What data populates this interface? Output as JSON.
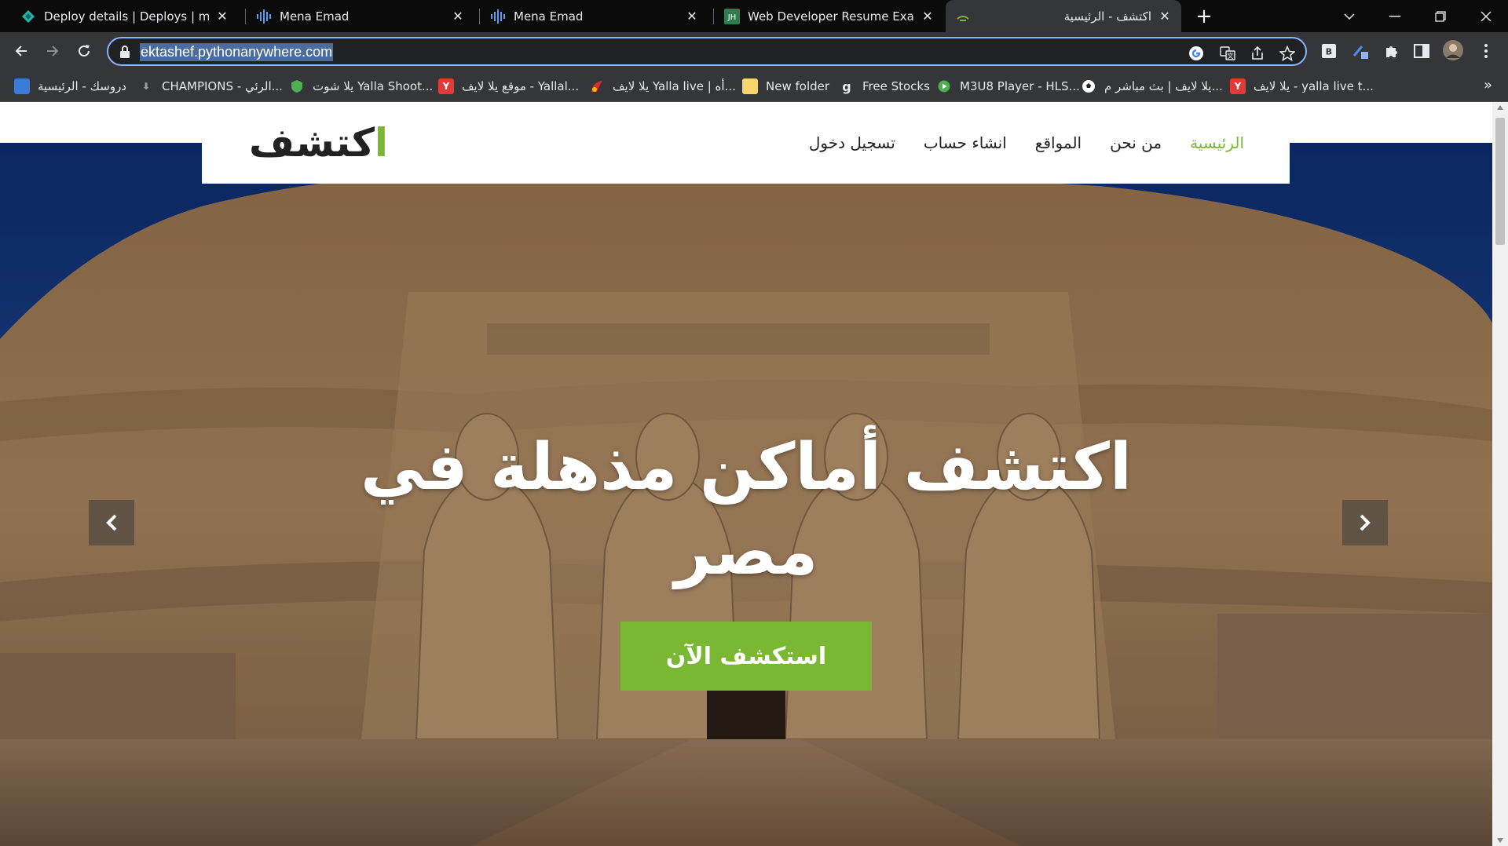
{
  "browser": {
    "tabs": [
      {
        "title": "Deploy details | Deploys | mina-e",
        "icon": "netlify-icon"
      },
      {
        "title": "Mena Emad",
        "icon": "waveform-icon"
      },
      {
        "title": "Mena Emad",
        "icon": "waveform-icon"
      },
      {
        "title": "Web Developer Resume Example",
        "icon": "jh-icon"
      },
      {
        "title": "اكتشف - الرئيسية",
        "icon": "site-icon",
        "active": true
      }
    ],
    "url": "ektashef.pythonanywhere.com",
    "bookmarks": [
      {
        "label": "دروسك - الرئيسية",
        "icon_color": "#3a7bd5"
      },
      {
        "label": "CHAMPIONS - الرئي...",
        "icon_color": "#9e9e9e"
      },
      {
        "label": "يلا شوت Yalla Shoot...",
        "icon_color": "#4caf50"
      },
      {
        "label": "موقع يلا لايف - Yallal...",
        "icon_color": "#e53935",
        "icon_letter": "Y"
      },
      {
        "label": "يلا لايف Yalla live | أه...",
        "icon_color": "#d32f2f"
      },
      {
        "label": "New folder",
        "icon_color": "#f9d56e"
      },
      {
        "label": "Free Stocks",
        "icon_color": "#35363a",
        "icon_letter": "g"
      },
      {
        "label": "M3U8 Player - HLS...",
        "icon_color": "#4caf50"
      },
      {
        "label": "يلا لايف | بث مباشر م...",
        "icon_color": "#ffffff"
      },
      {
        "label": "يلا لايف - yalla live t...",
        "icon_color": "#e53935",
        "icon_letter": "Y"
      }
    ],
    "extension_letter": "B",
    "favicon_letters": "JH"
  },
  "site": {
    "logo_accent": "ا",
    "logo_rest": "كتشف",
    "nav": [
      {
        "label": "الرئيسية",
        "active": true
      },
      {
        "label": "من نحن"
      },
      {
        "label": "المواقع"
      },
      {
        "label": "انشاء حساب"
      },
      {
        "label": "تسجيل دخول"
      }
    ],
    "hero": {
      "title_line1": "اكتشف أماكن مذهلة في",
      "title_line2": "مصر",
      "cta": "استكشف الآن"
    },
    "colors": {
      "accent": "#7ab833",
      "hero_sky": "#163a83",
      "rock": "#a9845f"
    }
  }
}
